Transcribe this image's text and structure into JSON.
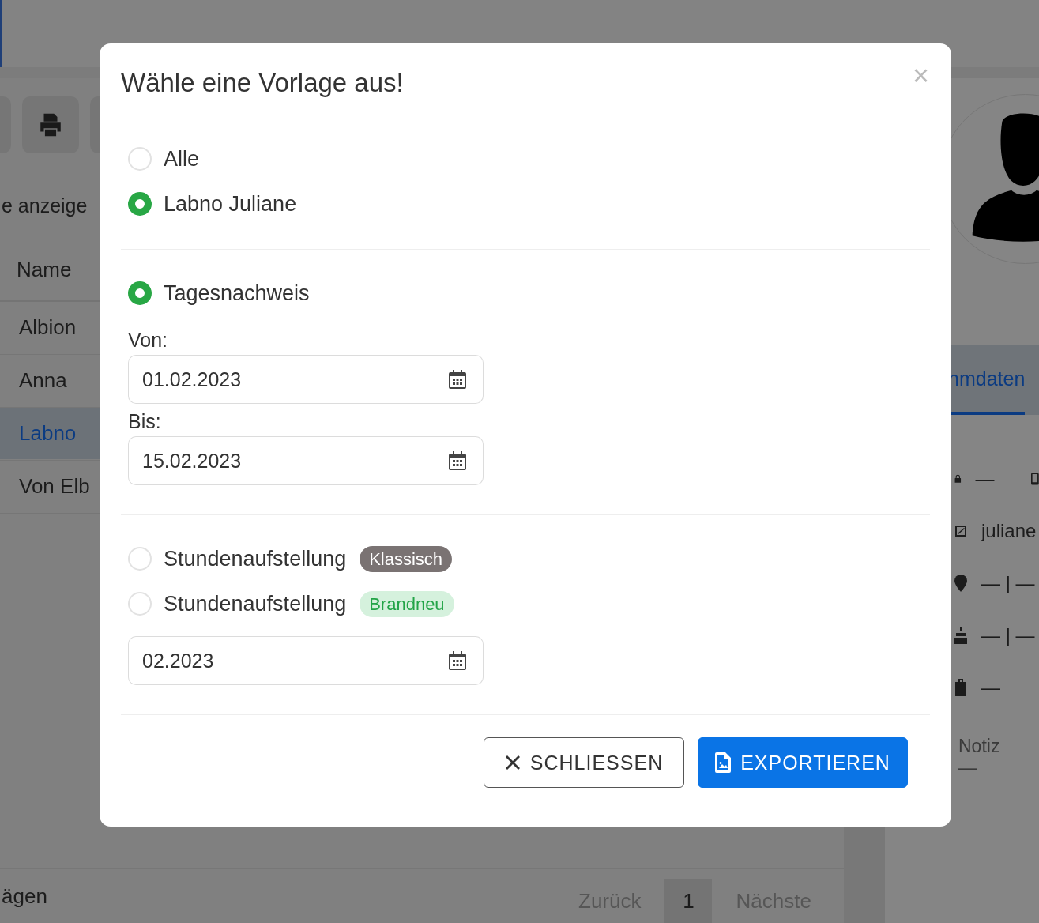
{
  "background": {
    "filter_label": "e anzeige",
    "table": {
      "columns": [
        "Name"
      ],
      "rows": [
        {
          "name": "Albion",
          "selected": false
        },
        {
          "name": "Anna",
          "selected": false
        },
        {
          "name": "Labno",
          "selected": true
        },
        {
          "name": "Von Elb",
          "selected": false
        }
      ]
    },
    "footer_text": "ägen",
    "pagination": {
      "previous": "Zurück",
      "pages": [
        {
          "label": "1",
          "selected": true
        }
      ],
      "next": "Nächste"
    },
    "profile": {
      "tabs": [
        {
          "label": "nmdaten",
          "selected": true
        }
      ],
      "details": [
        {
          "kind": "contact",
          "text": "—"
        },
        {
          "kind": "email",
          "text": "juliane"
        },
        {
          "kind": "address",
          "text": "— | —"
        },
        {
          "kind": "birthday",
          "text": "— | —"
        },
        {
          "kind": "work",
          "text": "—"
        }
      ],
      "note_label": "Notiz",
      "note_value": "—"
    }
  },
  "dialog": {
    "title": "Wähle eine Vorlage aus!",
    "close": "×",
    "sections": [
      {
        "options": [
          {
            "label": "Alle",
            "selected": false
          },
          {
            "label": "Labno Juliane",
            "selected": true
          }
        ]
      },
      {
        "options": [
          {
            "label": "Tagesnachweis",
            "selected": true
          }
        ],
        "fields": [
          {
            "label": "Von:",
            "value": "01.02.2023"
          },
          {
            "label": "Bis:",
            "value": "15.02.2023"
          }
        ]
      },
      {
        "options": [
          {
            "label": "Stundenaufstellung",
            "selected": false,
            "badge": {
              "text": "Klassisch",
              "kind": "neutral"
            }
          },
          {
            "label": "Stundenaufstellung",
            "selected": false,
            "badge": {
              "text": "Brandneu",
              "kind": "new"
            }
          }
        ],
        "fields": [
          {
            "value": "02.2023"
          }
        ]
      }
    ],
    "buttons": [
      {
        "label": "SCHLIESSEN",
        "kind": "secondary"
      },
      {
        "label": "EXPORTIEREN",
        "kind": "primary"
      }
    ]
  }
}
